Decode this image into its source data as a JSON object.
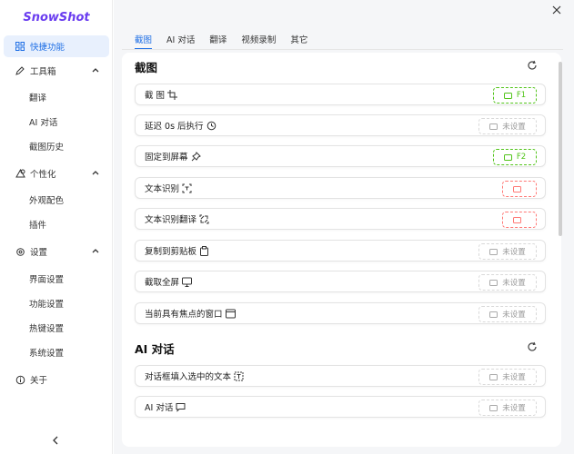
{
  "app": {
    "name": "SnowShot"
  },
  "sidebar": {
    "items": [
      {
        "label": "快捷功能"
      },
      {
        "label": "工具箱"
      },
      {
        "label": "翻译"
      },
      {
        "label": "AI 对话"
      },
      {
        "label": "截图历史"
      },
      {
        "label": "个性化"
      },
      {
        "label": "外观配色"
      },
      {
        "label": "插件"
      },
      {
        "label": "设置"
      },
      {
        "label": "界面设置"
      },
      {
        "label": "功能设置"
      },
      {
        "label": "热键设置"
      },
      {
        "label": "系统设置"
      },
      {
        "label": "关于"
      }
    ]
  },
  "tabs": [
    {
      "label": "截图"
    },
    {
      "label": "AI 对话"
    },
    {
      "label": "翻译"
    },
    {
      "label": "视频录制"
    },
    {
      "label": "其它"
    }
  ],
  "sections": {
    "screenshot": {
      "title": "截图",
      "rows": [
        {
          "label": "截 图",
          "key": "F1"
        },
        {
          "label": "延迟 0s 后执行",
          "key": "未设置"
        },
        {
          "label": "固定到屏幕",
          "key": "F2"
        },
        {
          "label": "文本识别",
          "key": ""
        },
        {
          "label": "文本识别翻译",
          "key": ""
        },
        {
          "label": "复制到剪贴板",
          "key": "未设置"
        },
        {
          "label": "截取全屏",
          "key": "未设置"
        },
        {
          "label": "当前具有焦点的窗口",
          "key": "未设置"
        }
      ]
    },
    "ai_chat": {
      "title": "AI 对话",
      "rows": [
        {
          "label": "对话框填入选中的文本",
          "key": "未设置"
        },
        {
          "label": "AI 对话",
          "key": "未设置"
        }
      ]
    }
  },
  "colors": {
    "accent": "#1f6fe5",
    "logo": "#6a3df0",
    "key_set": "#52c41a",
    "key_conflict": "#ff7875"
  }
}
